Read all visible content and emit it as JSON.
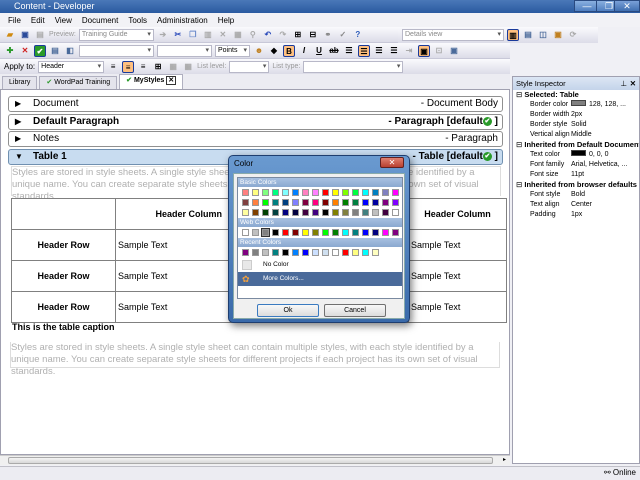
{
  "window": {
    "title": "Content - Developer"
  },
  "menu": [
    "File",
    "Edit",
    "View",
    "Document",
    "Tools",
    "Administration",
    "Help"
  ],
  "toolbar": {
    "preview_label": "Preview:",
    "preview_value": "Training Guide",
    "view_value": "Details view",
    "size_unit": "Points",
    "apply_to_label": "Apply to:",
    "apply_to_value": "Header",
    "list_level_label": "List level:",
    "list_type_label": "List type:"
  },
  "tabs": [
    {
      "label": "Library"
    },
    {
      "label": "WordPad Training"
    },
    {
      "label": "MyStyles"
    }
  ],
  "styles": [
    {
      "name": "Document",
      "type": "- Document Body",
      "bold": false
    },
    {
      "name": "Default Paragraph",
      "type": "- Paragraph [default",
      "bold": true
    },
    {
      "name": "Notes",
      "type": "- Paragraph",
      "bold": false
    },
    {
      "name": "Table 1",
      "type": "- Table [default",
      "bold": true
    }
  ],
  "preview": {
    "text1": "Styles are stored in style sheets. A single style sheet can contain multiple styles, with each style identified by a unique name. You can create separate style sheets for different projects if each project has its own set of visual standards.",
    "header_column": "Header Column",
    "header_row": "Header Row",
    "sample_text": "Sample Text",
    "caption": "This is the table caption",
    "text2": "Styles are stored in style sheets. A single style sheet can contain multiple styles, with each style identified by a unique name. You can create separate style sheets for different projects if each project has its own set of visual standards."
  },
  "inspector": {
    "title": "Style Inspector",
    "sections": [
      {
        "title": "Selected: Table",
        "props": [
          {
            "k": "Border color",
            "v": "128, 128, ...",
            "swatch": "#808080"
          },
          {
            "k": "Border width",
            "v": "2px"
          },
          {
            "k": "Border style",
            "v": "Solid"
          },
          {
            "k": "Vertical align",
            "v": "Middle"
          }
        ]
      },
      {
        "title": "Inherited from Default Document",
        "props": [
          {
            "k": "Text color",
            "v": "0, 0, 0",
            "swatch": "#000000"
          },
          {
            "k": "Font family",
            "v": "Arial, Helvetica, ..."
          },
          {
            "k": "Font size",
            "v": "11pt"
          }
        ]
      },
      {
        "title": "Inherited from browser defaults",
        "props": [
          {
            "k": "Font style",
            "v": "Bold"
          },
          {
            "k": "Text align",
            "v": "Center"
          },
          {
            "k": "Padding",
            "v": "1px"
          }
        ]
      }
    ]
  },
  "dialog": {
    "title": "Color",
    "basic_label": "Basic Colors",
    "web_label": "Web Colors",
    "recent_label": "Recent Colors",
    "no_color": "No Color",
    "more_colors": "More Colors...",
    "ok": "Ok",
    "cancel": "Cancel",
    "basic": [
      "#ff8080",
      "#ffff80",
      "#80ff80",
      "#00ff80",
      "#80ffff",
      "#0080ff",
      "#ff80c0",
      "#ff80ff",
      "#ff0000",
      "#ffff00",
      "#80ff00",
      "#00ff40",
      "#00ffff",
      "#0080c0",
      "#8080c0",
      "#ff00ff",
      "#804040",
      "#ff8040",
      "#00ff00",
      "#008080",
      "#004080",
      "#8080ff",
      "#800040",
      "#ff0080",
      "#800000",
      "#ff8000",
      "#008000",
      "#008040",
      "#0000ff",
      "#0000a0",
      "#800080",
      "#8000ff",
      "#ffffa0",
      "#804000",
      "#004000",
      "#004040",
      "#000080",
      "#000040",
      "#400040",
      "#400080",
      "#000000",
      "#808000",
      "#808040",
      "#808080",
      "#408080",
      "#c0c0c0",
      "#400040",
      "#ffffff"
    ],
    "web": [
      "#ffffff",
      "#c0c0c0",
      "#808080",
      "#000000",
      "#ff0000",
      "#800000",
      "#ffff00",
      "#808000",
      "#00ff00",
      "#008000",
      "#00ffff",
      "#008080",
      "#0000ff",
      "#000080",
      "#ff00ff",
      "#800080"
    ],
    "recent": [
      "#800080",
      "#808080",
      "#c0c0c0",
      "#008080",
      "#000000",
      "#0080ff",
      "#0000ff",
      "#cce0ff",
      "#d0e0f0",
      "#ffffff",
      "#ff0000",
      "#ffff80",
      "#00ffff",
      "#ffffc0"
    ]
  },
  "status": {
    "connection": "Online"
  }
}
